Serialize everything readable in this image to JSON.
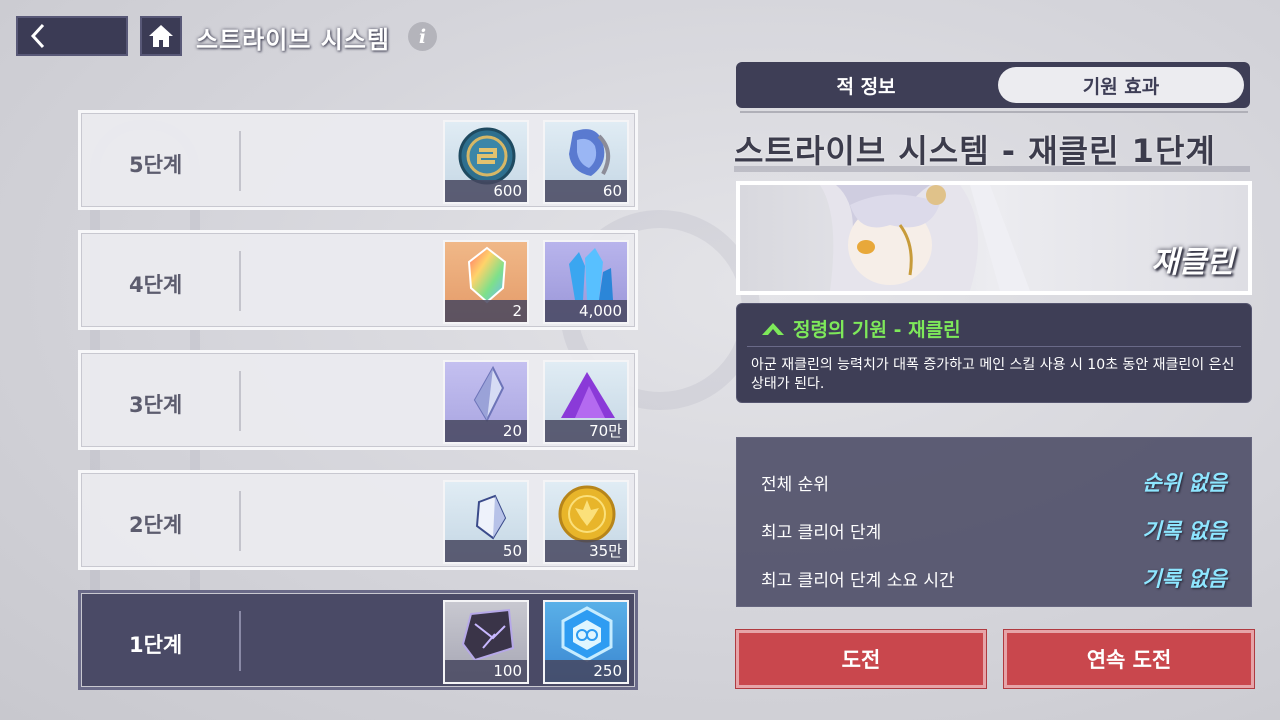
{
  "header": {
    "title": "스트라이브 시스템",
    "info_glyph": "i"
  },
  "stages": [
    {
      "label": "5단계",
      "selected": false,
      "rewards": [
        {
          "icon": "coin-emblem-icon",
          "count": "600"
        },
        {
          "icon": "potion-flask-icon",
          "count": "60"
        }
      ]
    },
    {
      "label": "4단계",
      "selected": false,
      "rewards": [
        {
          "icon": "rainbow-crystal-icon",
          "count": "2"
        },
        {
          "icon": "blue-crystal-icon",
          "count": "4,000"
        }
      ]
    },
    {
      "label": "3단계",
      "selected": false,
      "rewards": [
        {
          "icon": "silver-gem-icon",
          "count": "20"
        },
        {
          "icon": "purple-powder-icon",
          "count": "70만"
        }
      ]
    },
    {
      "label": "2단계",
      "selected": false,
      "rewards": [
        {
          "icon": "white-gem-icon",
          "count": "50"
        },
        {
          "icon": "gold-coin-icon",
          "count": "35만"
        }
      ]
    },
    {
      "label": "1단계",
      "selected": true,
      "rewards": [
        {
          "icon": "dark-cube-icon",
          "count": "100"
        },
        {
          "icon": "hex-crystal-icon",
          "count": "250"
        }
      ]
    }
  ],
  "tabs": {
    "enemy": "적 정보",
    "origin": "기원 효과"
  },
  "detail": {
    "heading": "스트라이브 시스템 - 재클린 1단계",
    "character_name": "재클린",
    "origin_title": "정령의 기원 - 재클린",
    "origin_desc": "아군 재클린의 능력치가 대폭 증가하고 메인 스킬 사용 시 10초 동안 재클린이 은신 상태가 된다."
  },
  "stats": [
    {
      "label": "전체 순위",
      "value": "순위 없음"
    },
    {
      "label": "최고 클리어 단계",
      "value": "기록 없음"
    },
    {
      "label": "최고 클리어 단계 소요 시간",
      "value": "기록 없음"
    }
  ],
  "buttons": {
    "challenge": "도전",
    "repeat": "연속 도전"
  },
  "colors": {
    "panel_dark": "#3e3e56",
    "accent_green": "#7ee95a",
    "value_cyan": "#8ee6ff",
    "button_red": "#c9474d"
  }
}
